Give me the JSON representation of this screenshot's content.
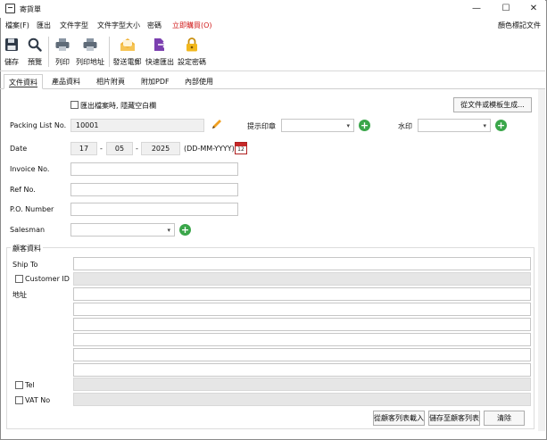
{
  "window": {
    "title": "寄貨單",
    "minimize": "—",
    "maximize": "☐",
    "close": "✕"
  },
  "menu": {
    "items": [
      "檔案(F)",
      "匯出",
      "文件字型",
      "文件字型大小",
      "密碼"
    ],
    "buy_label": "立即購買(O)",
    "right_label": "顏色標記文件",
    "buy_color": "#d01818"
  },
  "toolbar": {
    "save": "儲存",
    "preview": "預覽",
    "print": "列印",
    "print_address": "列印地址",
    "send_email": "發送電郵",
    "quick_export": "快速匯出",
    "set_password": "設定密碼"
  },
  "tabs": [
    "文件資料",
    "產品資料",
    "相片附頁",
    "附加PDF",
    "內部使用"
  ],
  "form": {
    "hide_blank_label": "匯出檔案時, 隱藏空白欄",
    "generate_from_doc_button": "從文件或模板生成...",
    "packing_list_label": "Packing List No.",
    "packing_list_value": "10001",
    "stamp_label": "提示印章",
    "watermark_label": "水印",
    "date_label": "Date",
    "date_day": "17",
    "date_month": "05",
    "date_year": "2025",
    "date_sep": "-",
    "date_format": "(DD-MM-YYYY)",
    "calendar_day": "12",
    "invoice_label": "Invoice No.",
    "ref_label": "Ref No.",
    "po_label": "P.O. Number",
    "salesman_label": "Salesman"
  },
  "customer": {
    "group_label": "顧客資料",
    "ship_to_label": "Ship To",
    "customer_id_label": "Customer ID",
    "address_label": "地址",
    "tel_label": "Tel",
    "vat_label": "VAT No",
    "load_button": "從顧客列表載入",
    "save_button": "儲存至顧客列表",
    "clear_button": "清除"
  },
  "colors": {
    "accent_green": "#3aa64a",
    "accent_red": "#d01818"
  }
}
